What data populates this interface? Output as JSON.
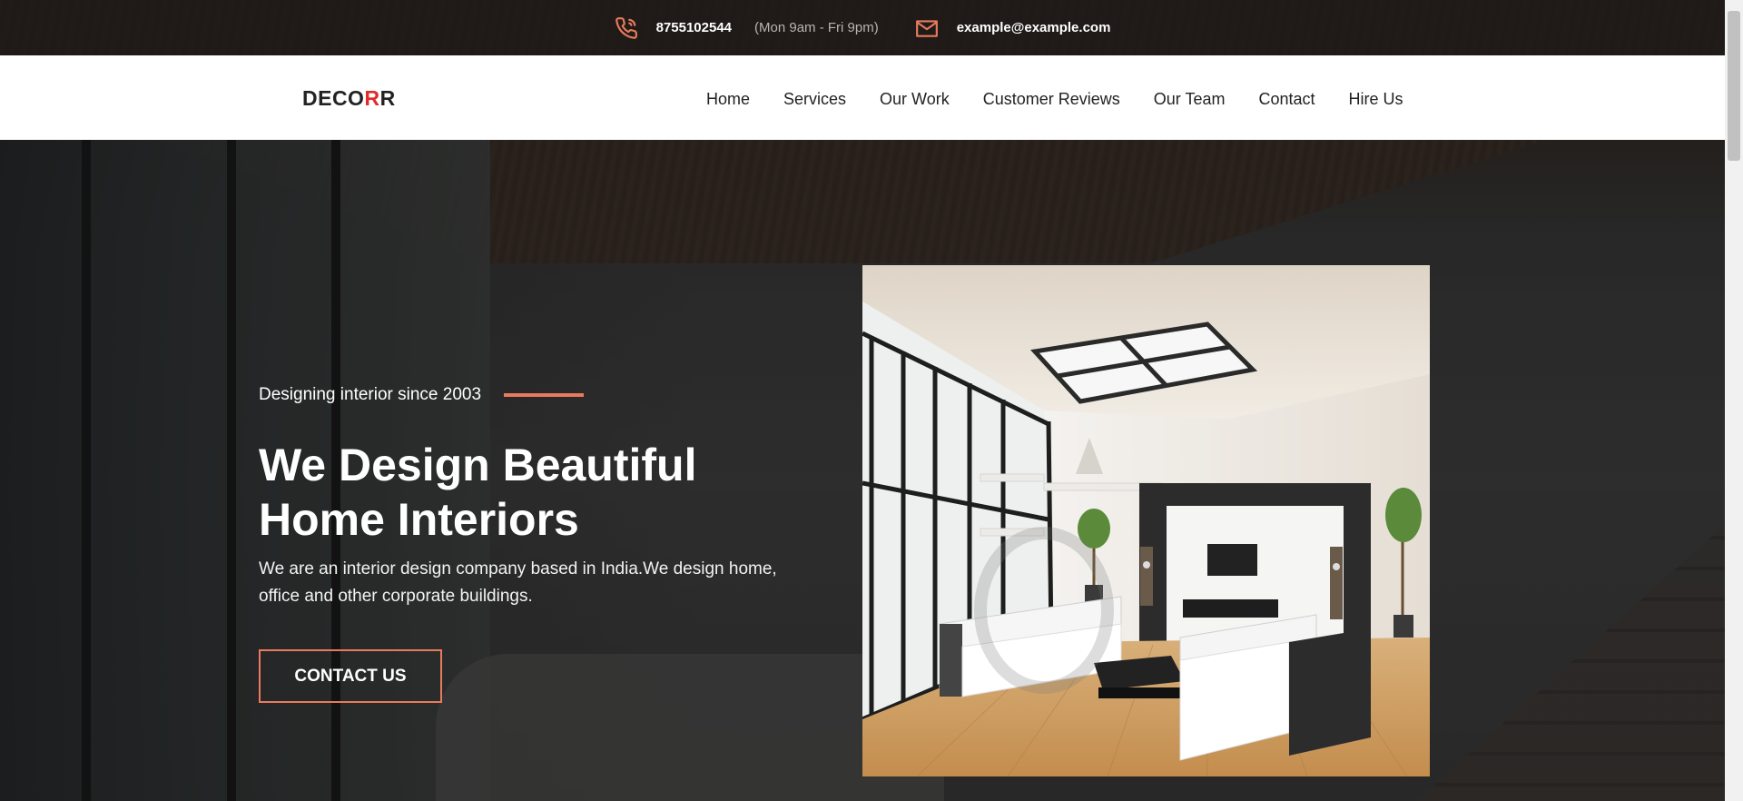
{
  "topbar": {
    "phone_icon": "phone-icon",
    "phone": "8755102544",
    "hours": "(Mon 9am - Fri 9pm)",
    "mail_icon": "mail-icon",
    "email": "example@example.com"
  },
  "navbar": {
    "brand_prefix": "DECO",
    "brand_accent": "R",
    "brand_suffix": "R",
    "links": [
      "Home",
      "Services",
      "Our Work",
      "Customer Reviews",
      "Our Team",
      "Contact",
      "Hire Us"
    ]
  },
  "hero": {
    "tagline": "Designing interior since 2003",
    "title": "We Design Beautiful Home Interiors",
    "description": "We are an interior design company based in India.We design home, office and other corporate buildings.",
    "cta_label": "CONTACT US"
  },
  "colors": {
    "accent": "#e87a5d",
    "brand_accent": "#e02b2b",
    "navbar_bg": "#ffffff"
  }
}
